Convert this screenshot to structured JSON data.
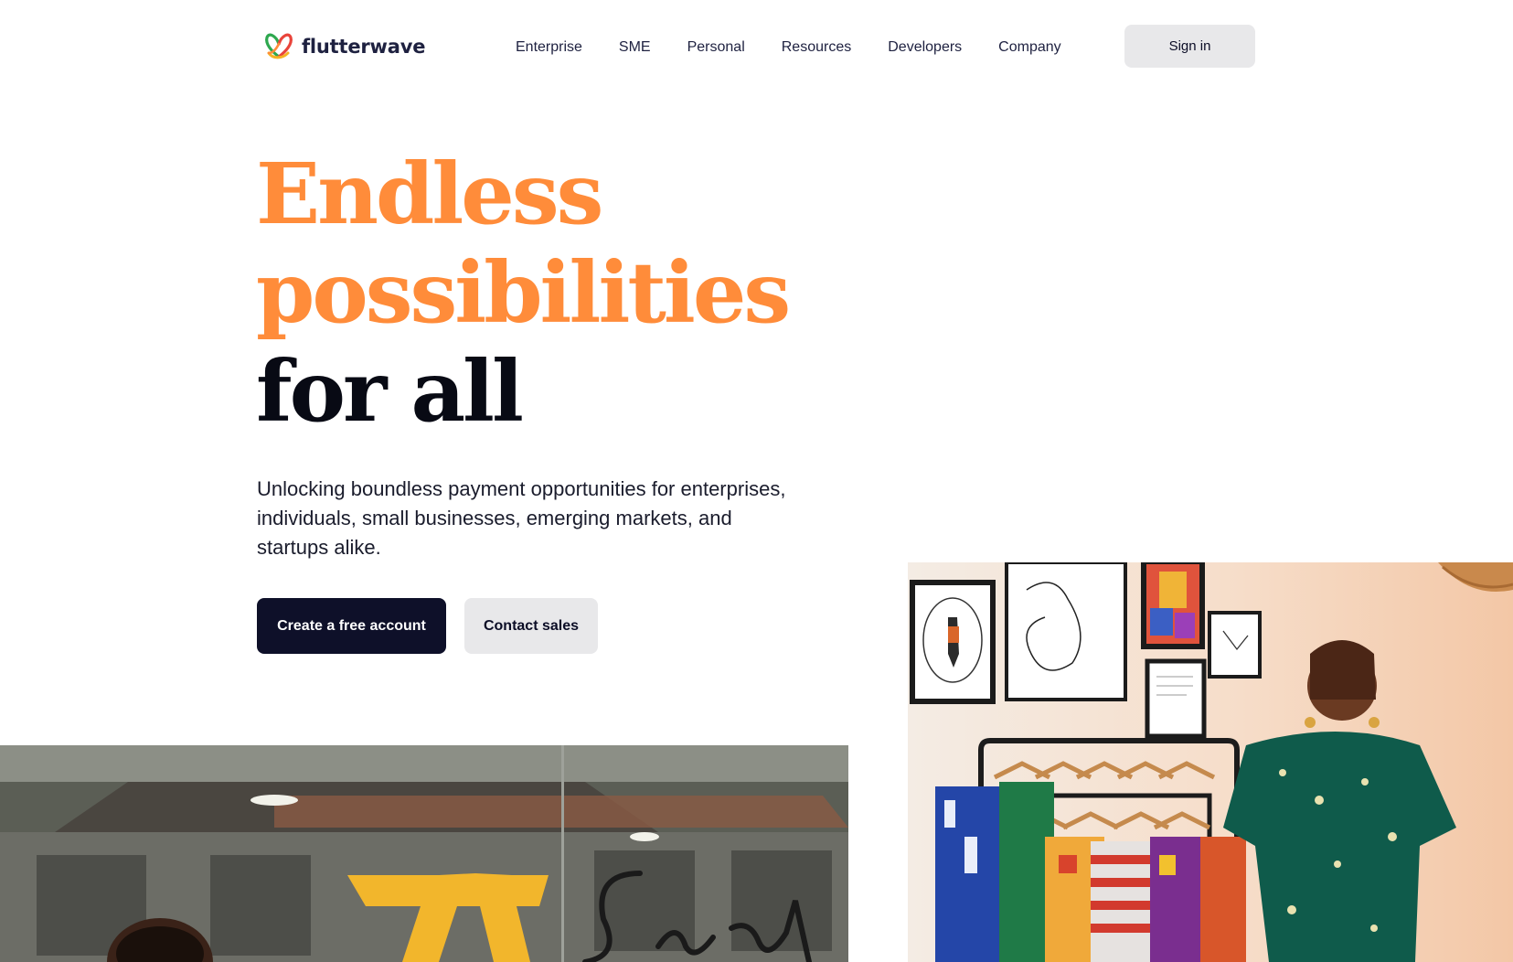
{
  "brand": {
    "name": "flutterwave",
    "colors": {
      "orange": "#ff8c3a",
      "navy": "#0e1029",
      "gray_button": "#e8e8ea",
      "logo_green": "#2ea84f",
      "logo_red": "#e9443b",
      "logo_yellow": "#f5b324"
    }
  },
  "header": {
    "logo_icon": "flutterwave-butterfly-logo",
    "nav": [
      {
        "label": "Enterprise"
      },
      {
        "label": "SME"
      },
      {
        "label": "Personal"
      },
      {
        "label": "Resources"
      },
      {
        "label": "Developers"
      },
      {
        "label": "Company"
      }
    ],
    "signin_label": "Sign in"
  },
  "hero": {
    "headline_line1": "Endless",
    "headline_line2": "possibilities",
    "headline_line3": "for all",
    "subtitle": "Unlocking boundless payment opportunities for enterprises, individuals, small businesses, emerging markets, and startups alike.",
    "primary_cta": "Create a free account",
    "secondary_cta": "Contact sales"
  },
  "photos": {
    "left": "storefront-photo",
    "right": "clothing-rack-photo"
  }
}
